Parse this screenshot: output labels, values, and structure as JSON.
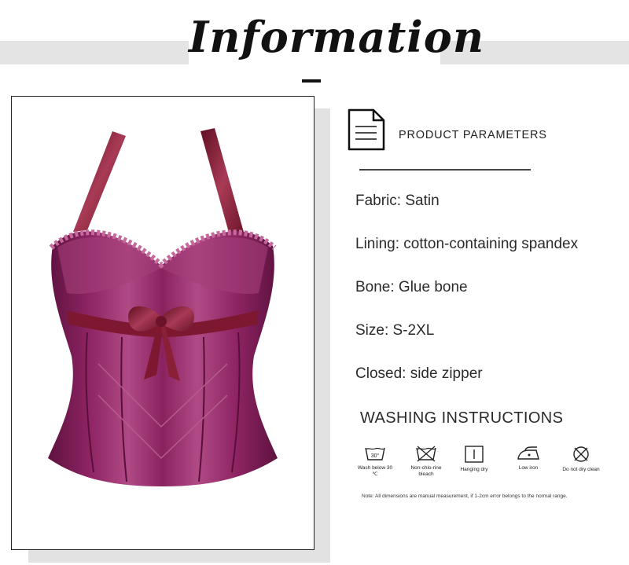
{
  "header": {
    "title": "Information"
  },
  "product_image": {
    "alt": "corset"
  },
  "parameters": {
    "heading": "PRODUCT PARAMETERS",
    "items": [
      "Fabric: Satin",
      "Lining: cotton-containing spandex",
      "Bone: Glue bone",
      "Size: S-2XL",
      "Closed: side zipper"
    ]
  },
  "washing": {
    "heading": "WASHING INSTRUCTIONS",
    "items": [
      {
        "icon": "wash-30-icon",
        "label": "Wash below 30 ℃",
        "symbol_text": "30°"
      },
      {
        "icon": "no-bleach-icon",
        "label": "Non-chlo-rine bleach"
      },
      {
        "icon": "hanging-dry-icon",
        "label": "Hanging dry"
      },
      {
        "icon": "low-iron-icon",
        "label": "Low iron"
      },
      {
        "icon": "no-dry-clean-icon",
        "label": "Do not dry clean"
      }
    ],
    "note": "Note: All dimensions are manual measurement, if 1-2cm error belongs to the normal range."
  },
  "colors": {
    "fabric": "#8e2463",
    "ribbon": "#7d1830",
    "band": "#e4e4e4"
  }
}
